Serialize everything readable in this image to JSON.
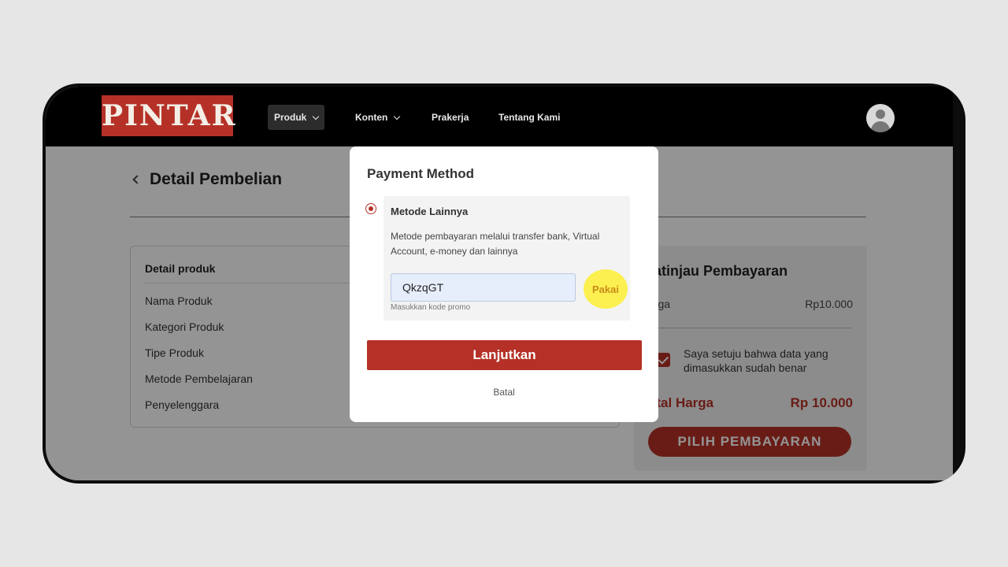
{
  "navbar": {
    "logo": "PINTAR",
    "items": [
      {
        "label": "Produk"
      },
      {
        "label": "Konten"
      },
      {
        "label": "Prakerja"
      },
      {
        "label": "Tentang Kami"
      }
    ]
  },
  "page": {
    "title": "Detail Pembelian"
  },
  "detail_card": {
    "title": "Detail produk",
    "rows": [
      "Nama Produk",
      "Kategori Produk",
      "Tipe Produk",
      "Metode Pembelajaran",
      "Penyelenggara"
    ]
  },
  "summary": {
    "title": "ratinjau Pembayaran",
    "harga_label": "arga",
    "harga_value": "Rp10.000",
    "agree_text": "Saya setuju bahwa data yang dimasukkan sudah benar",
    "total_label": "otal Harga",
    "total_value": "Rp 10.000",
    "pay_button": "PILIH PEMBAYARAN"
  },
  "modal": {
    "title": "Payment Method",
    "method_title": "Metode Lainnya",
    "method_desc": "Metode pembayaran melalui transfer bank, Virtual Account, e-money dan lainnya",
    "promo_value": "QkzqGT",
    "promo_hint": "Masukkan kode promo",
    "use_button": "Pakai",
    "continue_button": "Lanjutkan",
    "cancel_link": "Batal"
  },
  "colors": {
    "brand": "#b53127",
    "highlight": "#fbf04f",
    "input_bg": "#e7eefb"
  }
}
